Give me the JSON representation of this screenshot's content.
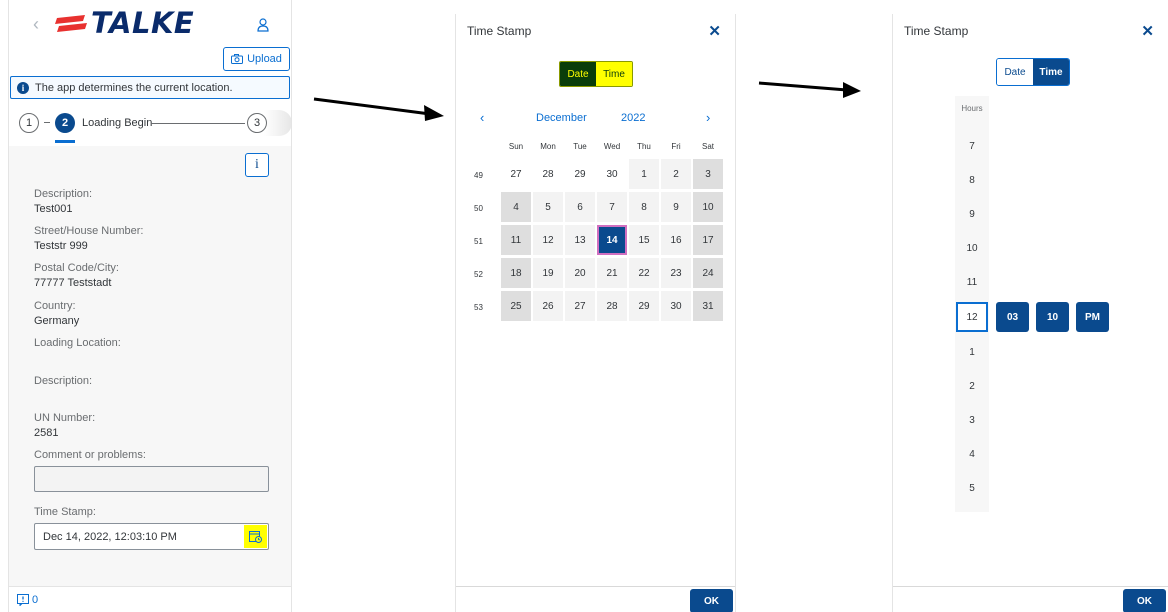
{
  "app": {
    "brand": "TALKE",
    "upload_label": "Upload",
    "info_message": "The app determines the current location.",
    "steps": {
      "step1": "1",
      "step2": "2",
      "step2_label": "Loading Begin",
      "step3": "3"
    },
    "info_button": "i",
    "fields": {
      "description_label": "Description:",
      "description_value": "Test001",
      "street_label": "Street/House Number:",
      "street_value": "Teststr 999",
      "postal_label": "Postal Code/City:",
      "postal_value": "77777 Teststadt",
      "country_label": "Country:",
      "country_value": "Germany",
      "loading_location_label": "Loading Location:",
      "description2_label": "Description:",
      "un_number_label": "UN Number:",
      "un_number_value": "2581",
      "comment_label": "Comment or problems:",
      "timestamp_label": "Time Stamp:",
      "timestamp_value": "Dec 14, 2022, 12:03:10 PM"
    },
    "footer_count": "0"
  },
  "date_dialog": {
    "title": "Time Stamp",
    "close": "✕",
    "seg_date": "Date",
    "seg_time": "Time",
    "prev": "‹",
    "next": "›",
    "month": "December",
    "year": "2022",
    "weekday_headers": [
      "Sun",
      "Mon",
      "Tue",
      "Wed",
      "Thu",
      "Fri",
      "Sat"
    ],
    "weeks": [
      {
        "week": "49",
        "days": [
          "27",
          "28",
          "29",
          "30",
          "1",
          "2",
          "3"
        ]
      },
      {
        "week": "50",
        "days": [
          "4",
          "5",
          "6",
          "7",
          "8",
          "9",
          "10"
        ]
      },
      {
        "week": "51",
        "days": [
          "11",
          "12",
          "13",
          "14",
          "15",
          "16",
          "17"
        ]
      },
      {
        "week": "52",
        "days": [
          "18",
          "19",
          "20",
          "21",
          "22",
          "23",
          "24"
        ]
      },
      {
        "week": "53",
        "days": [
          "25",
          "26",
          "27",
          "28",
          "29",
          "30",
          "31"
        ]
      }
    ],
    "ok": "OK"
  },
  "time_dialog": {
    "title": "Time Stamp",
    "close": "✕",
    "seg_date": "Date",
    "seg_time": "Time",
    "hours_label": "Hours",
    "hours_above": [
      "7",
      "8",
      "9",
      "10",
      "11"
    ],
    "hour_selected": "12",
    "hours_below": [
      "1",
      "2",
      "3",
      "4",
      "5"
    ],
    "minutes": "03",
    "seconds": "10",
    "period": "PM",
    "ok": "OK"
  },
  "colors": {
    "highlight_yellow": "#ffff00",
    "accent_blue": "#0a4a8e",
    "link_blue": "#0a6ed1",
    "dark_green": "#0a3d0a",
    "selected_day_border": "#d06fc0"
  }
}
